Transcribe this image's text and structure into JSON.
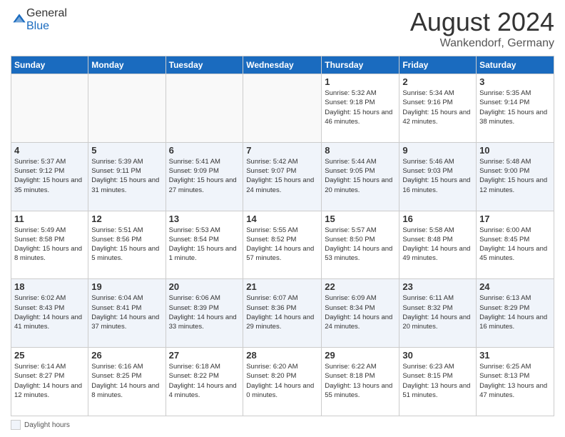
{
  "header": {
    "logo_general": "General",
    "logo_blue": "Blue",
    "main_title": "August 2024",
    "subtitle": "Wankendorf, Germany"
  },
  "calendar": {
    "days_of_week": [
      "Sunday",
      "Monday",
      "Tuesday",
      "Wednesday",
      "Thursday",
      "Friday",
      "Saturday"
    ],
    "weeks": [
      [
        {
          "day": "",
          "info": ""
        },
        {
          "day": "",
          "info": ""
        },
        {
          "day": "",
          "info": ""
        },
        {
          "day": "",
          "info": ""
        },
        {
          "day": "1",
          "info": "Sunrise: 5:32 AM\nSunset: 9:18 PM\nDaylight: 15 hours and 46 minutes."
        },
        {
          "day": "2",
          "info": "Sunrise: 5:34 AM\nSunset: 9:16 PM\nDaylight: 15 hours and 42 minutes."
        },
        {
          "day": "3",
          "info": "Sunrise: 5:35 AM\nSunset: 9:14 PM\nDaylight: 15 hours and 38 minutes."
        }
      ],
      [
        {
          "day": "4",
          "info": "Sunrise: 5:37 AM\nSunset: 9:12 PM\nDaylight: 15 hours and 35 minutes."
        },
        {
          "day": "5",
          "info": "Sunrise: 5:39 AM\nSunset: 9:11 PM\nDaylight: 15 hours and 31 minutes."
        },
        {
          "day": "6",
          "info": "Sunrise: 5:41 AM\nSunset: 9:09 PM\nDaylight: 15 hours and 27 minutes."
        },
        {
          "day": "7",
          "info": "Sunrise: 5:42 AM\nSunset: 9:07 PM\nDaylight: 15 hours and 24 minutes."
        },
        {
          "day": "8",
          "info": "Sunrise: 5:44 AM\nSunset: 9:05 PM\nDaylight: 15 hours and 20 minutes."
        },
        {
          "day": "9",
          "info": "Sunrise: 5:46 AM\nSunset: 9:03 PM\nDaylight: 15 hours and 16 minutes."
        },
        {
          "day": "10",
          "info": "Sunrise: 5:48 AM\nSunset: 9:00 PM\nDaylight: 15 hours and 12 minutes."
        }
      ],
      [
        {
          "day": "11",
          "info": "Sunrise: 5:49 AM\nSunset: 8:58 PM\nDaylight: 15 hours and 8 minutes."
        },
        {
          "day": "12",
          "info": "Sunrise: 5:51 AM\nSunset: 8:56 PM\nDaylight: 15 hours and 5 minutes."
        },
        {
          "day": "13",
          "info": "Sunrise: 5:53 AM\nSunset: 8:54 PM\nDaylight: 15 hours and 1 minute."
        },
        {
          "day": "14",
          "info": "Sunrise: 5:55 AM\nSunset: 8:52 PM\nDaylight: 14 hours and 57 minutes."
        },
        {
          "day": "15",
          "info": "Sunrise: 5:57 AM\nSunset: 8:50 PM\nDaylight: 14 hours and 53 minutes."
        },
        {
          "day": "16",
          "info": "Sunrise: 5:58 AM\nSunset: 8:48 PM\nDaylight: 14 hours and 49 minutes."
        },
        {
          "day": "17",
          "info": "Sunrise: 6:00 AM\nSunset: 8:45 PM\nDaylight: 14 hours and 45 minutes."
        }
      ],
      [
        {
          "day": "18",
          "info": "Sunrise: 6:02 AM\nSunset: 8:43 PM\nDaylight: 14 hours and 41 minutes."
        },
        {
          "day": "19",
          "info": "Sunrise: 6:04 AM\nSunset: 8:41 PM\nDaylight: 14 hours and 37 minutes."
        },
        {
          "day": "20",
          "info": "Sunrise: 6:06 AM\nSunset: 8:39 PM\nDaylight: 14 hours and 33 minutes."
        },
        {
          "day": "21",
          "info": "Sunrise: 6:07 AM\nSunset: 8:36 PM\nDaylight: 14 hours and 29 minutes."
        },
        {
          "day": "22",
          "info": "Sunrise: 6:09 AM\nSunset: 8:34 PM\nDaylight: 14 hours and 24 minutes."
        },
        {
          "day": "23",
          "info": "Sunrise: 6:11 AM\nSunset: 8:32 PM\nDaylight: 14 hours and 20 minutes."
        },
        {
          "day": "24",
          "info": "Sunrise: 6:13 AM\nSunset: 8:29 PM\nDaylight: 14 hours and 16 minutes."
        }
      ],
      [
        {
          "day": "25",
          "info": "Sunrise: 6:14 AM\nSunset: 8:27 PM\nDaylight: 14 hours and 12 minutes."
        },
        {
          "day": "26",
          "info": "Sunrise: 6:16 AM\nSunset: 8:25 PM\nDaylight: 14 hours and 8 minutes."
        },
        {
          "day": "27",
          "info": "Sunrise: 6:18 AM\nSunset: 8:22 PM\nDaylight: 14 hours and 4 minutes."
        },
        {
          "day": "28",
          "info": "Sunrise: 6:20 AM\nSunset: 8:20 PM\nDaylight: 14 hours and 0 minutes."
        },
        {
          "day": "29",
          "info": "Sunrise: 6:22 AM\nSunset: 8:18 PM\nDaylight: 13 hours and 55 minutes."
        },
        {
          "day": "30",
          "info": "Sunrise: 6:23 AM\nSunset: 8:15 PM\nDaylight: 13 hours and 51 minutes."
        },
        {
          "day": "31",
          "info": "Sunrise: 6:25 AM\nSunset: 8:13 PM\nDaylight: 13 hours and 47 minutes."
        }
      ]
    ]
  },
  "footer": {
    "legend_label": "Daylight hours"
  }
}
